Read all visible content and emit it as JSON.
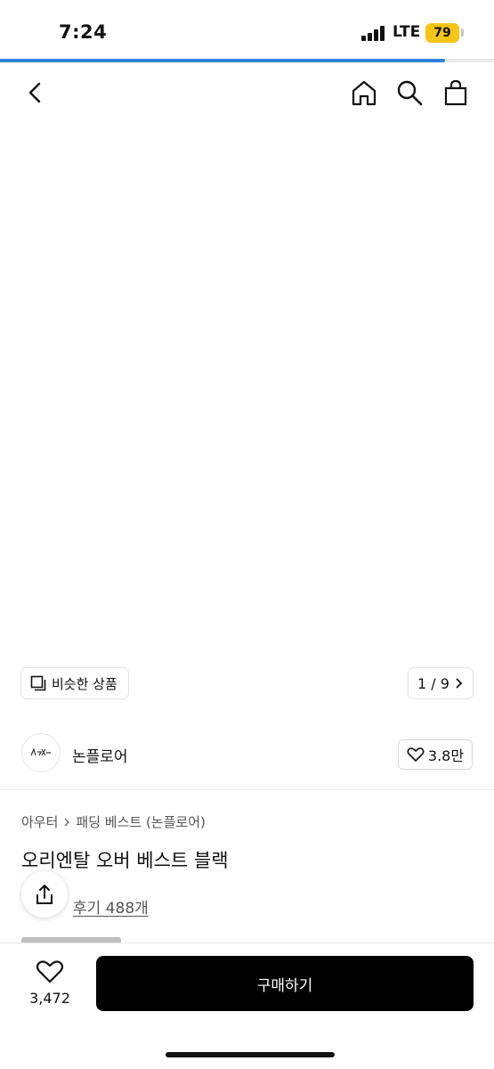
{
  "status": {
    "time": "7:24",
    "network": "LTE",
    "battery": "79"
  },
  "page_progress": 0.9,
  "nav": {
    "back_icon": "chevron-left-icon",
    "home_icon": "home-icon",
    "search_icon": "search-icon",
    "cart_icon": "shopping-bag-icon"
  },
  "gallery": {
    "similar_label": "비슷한 상품",
    "page_indicator": "1 / 9"
  },
  "brand": {
    "name": "논플로어",
    "likes": "3.8만"
  },
  "breadcrumb": {
    "category": "아우터",
    "subcategory": "패딩 베스트 (논플로어)"
  },
  "product": {
    "title": "오리엔탈 오버 베스트 블랙",
    "reviews": "후기 488개"
  },
  "bottom": {
    "wish_count": "3,472",
    "buy_label": "구매하기"
  }
}
